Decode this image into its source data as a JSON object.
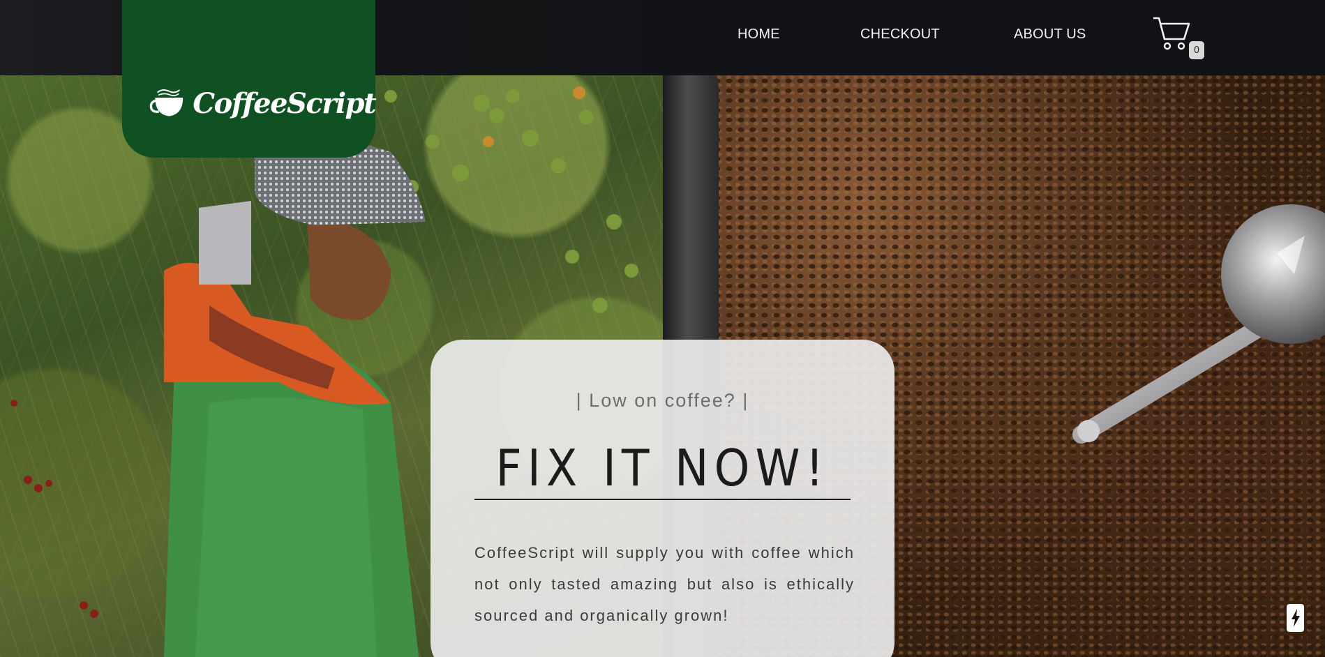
{
  "brand": {
    "name": "CoffeeScript",
    "logo_icon": "coffee-cup-icon",
    "color": "#0f5123"
  },
  "nav": {
    "items": [
      {
        "label": "HOME"
      },
      {
        "label": "CHECKOUT"
      },
      {
        "label": "ABOUT US"
      }
    ],
    "cart": {
      "icon": "cart-icon",
      "count": "0"
    }
  },
  "hero": {
    "left_image": "coffee-farmer-photo",
    "right_image": "roasting-coffee-beans-photo"
  },
  "promo": {
    "kicker": "| Low on coffee? |",
    "headline": "FIX IT NOW!",
    "body": "CoffeeScript will supply you with coffee which not only tasted amazing but also is ethically sourced and organically grown!"
  },
  "floating_badge": {
    "icon": "lightning-bolt-icon"
  }
}
